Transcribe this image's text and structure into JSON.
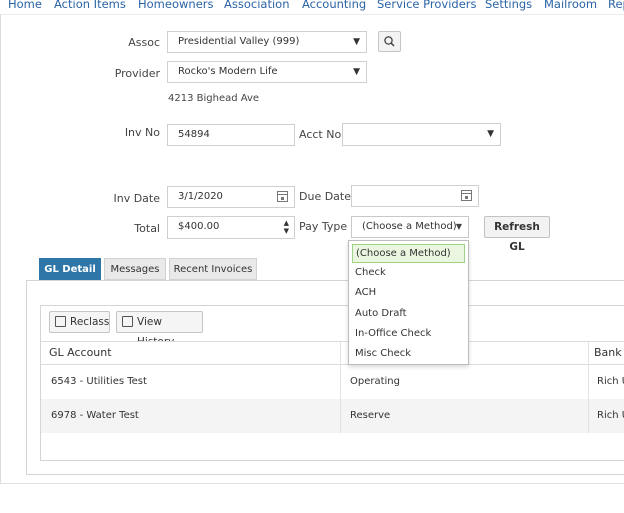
{
  "nav": {
    "items": [
      "Home",
      "Action Items",
      "Homeowners",
      "Association",
      "Accounting",
      "Service Providers",
      "Settings",
      "Mailroom",
      "Rep"
    ]
  },
  "form": {
    "assoc_label": "Assoc",
    "assoc_value": "Presidential Valley (999)",
    "provider_label": "Provider",
    "provider_value": "Rocko's Modern Life",
    "provider_address": "4213 Bighead Ave",
    "inv_no_label": "Inv No",
    "inv_no_value": "54894",
    "acct_no_label": "Acct No",
    "acct_no_value": "",
    "inv_date_label": "Inv Date",
    "inv_date_value": "3/1/2020",
    "due_date_label": "Due Date",
    "due_date_value": "",
    "total_label": "Total",
    "total_value": "$400.00",
    "pay_type_label": "Pay Type",
    "pay_type_value": "(Choose a Method)",
    "refresh_label": "Refresh GL"
  },
  "pay_type_options": [
    "(Choose a Method)",
    "Check",
    "ACH",
    "Auto Draft",
    "In-Office Check",
    "Misc Check"
  ],
  "tabs": [
    "GL Detail",
    "Messages",
    "Recent Invoices"
  ],
  "toolbar": {
    "reclass_label": "Reclass",
    "history_label": "View History"
  },
  "table": {
    "columns": [
      "GL Account",
      "Bank"
    ],
    "rows": [
      {
        "gl_account": "6543 - Utilities Test",
        "fund": "Operating",
        "bank": "Rich U"
      },
      {
        "gl_account": "6978 - Water Test",
        "fund": "Reserve",
        "bank": "Rich U"
      }
    ]
  }
}
